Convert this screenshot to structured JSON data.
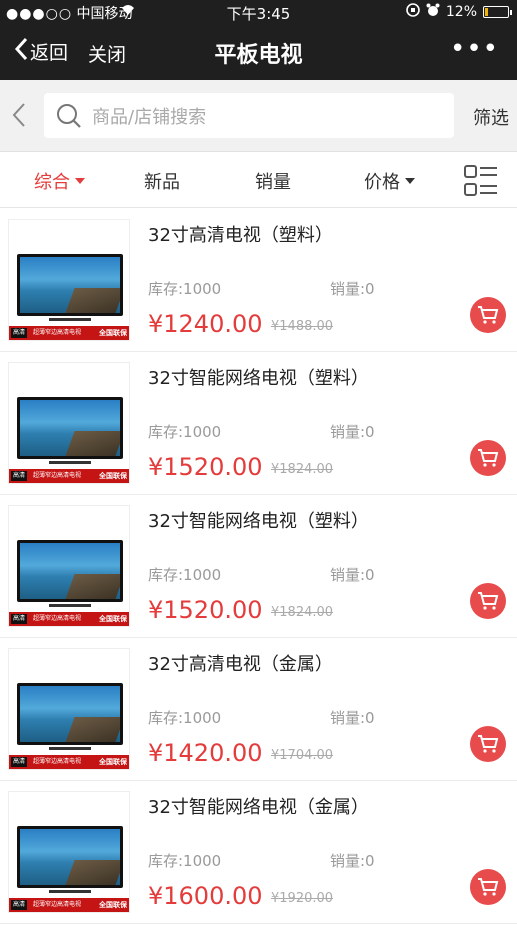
{
  "status_bar": {
    "signal": "●●●○○",
    "carrier": "中国移动",
    "time": "下午3:45",
    "battery": "12%",
    "battery_level": 0.12
  },
  "nav": {
    "back_label": "返回",
    "close_label": "关闭",
    "title": "平板电视",
    "more_label": "•••"
  },
  "search": {
    "placeholder": "商品/店铺搜索",
    "filter_label": "筛选"
  },
  "sort": {
    "tabs": [
      {
        "label": "综合",
        "active": true
      },
      {
        "label": "新品",
        "active": false
      },
      {
        "label": "销量",
        "active": false
      },
      {
        "label": "价格",
        "active": false
      }
    ]
  },
  "products": [
    {
      "name": "32寸高清电视（塑料）",
      "stock": "库存:1000",
      "sales": "销量:0",
      "price": "¥1240.00",
      "original_price": "¥1488.00"
    },
    {
      "name": "32寸智能网络电视（塑料）",
      "stock": "库存:1000",
      "sales": "销量:0",
      "price": "¥1520.00",
      "original_price": "¥1824.00"
    },
    {
      "name": "32寸智能网络电视（塑料）",
      "stock": "库存:1000",
      "sales": "销量:0",
      "price": "¥1520.00",
      "original_price": "¥1824.00"
    },
    {
      "name": "32寸高清电视（金属）",
      "stock": "库存:1000",
      "sales": "销量:0",
      "price": "¥1420.00",
      "original_price": "¥1704.00"
    },
    {
      "name": "32寸智能网络电视（金属）",
      "stock": "库存:1000",
      "sales": "销量:0",
      "price": "¥1600.00",
      "original_price": "¥1920.00"
    }
  ],
  "image_banner": {
    "left": "高清",
    "middle": "超薄窄边高清电视",
    "right": "全国联保"
  },
  "colors": {
    "accent": "#e43b3b",
    "nav_bg": "#1f1f1f",
    "cart_button": "#e84b4b"
  }
}
